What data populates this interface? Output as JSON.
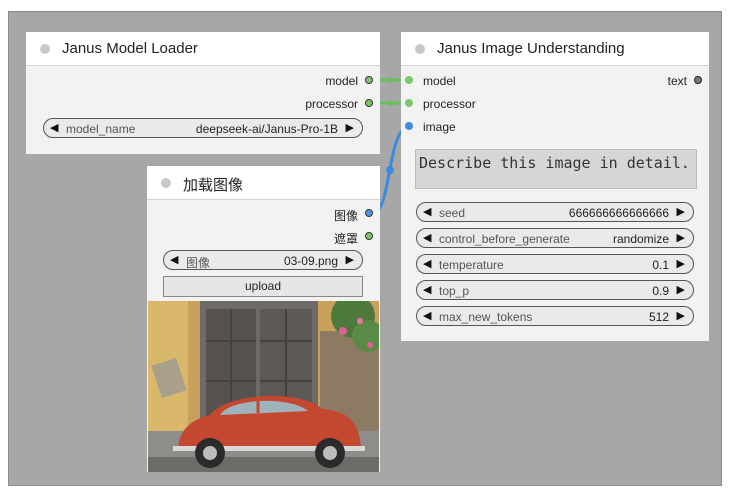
{
  "nodes": {
    "model_loader": {
      "title": "Janus Model Loader",
      "outputs": [
        "model",
        "processor"
      ],
      "widget": {
        "name": "model_name",
        "value": "deepseek-ai/Janus-Pro-1B"
      }
    },
    "load_image": {
      "title": "加载图像",
      "outputs": [
        "图像",
        "遮罩"
      ],
      "widget": {
        "name": "图像",
        "value": "03-09.png"
      },
      "upload_label": "upload"
    },
    "image_understanding": {
      "title": "Janus Image Understanding",
      "inputs": [
        "model",
        "processor",
        "image"
      ],
      "output": "text",
      "question": "Describe this image in detail.",
      "widgets": [
        {
          "name": "seed",
          "value": "666666666666666"
        },
        {
          "name": "control_before_generate",
          "value": "randomize"
        },
        {
          "name": "temperature",
          "value": "0.1"
        },
        {
          "name": "top_p",
          "value": "0.9"
        },
        {
          "name": "max_new_tokens",
          "value": "512"
        }
      ]
    }
  },
  "colors": {
    "canvas": "#a7a7a7",
    "node_body": "#f2f2f2",
    "link_green": "#6abf5a",
    "link_blue": "#3b8be0"
  }
}
